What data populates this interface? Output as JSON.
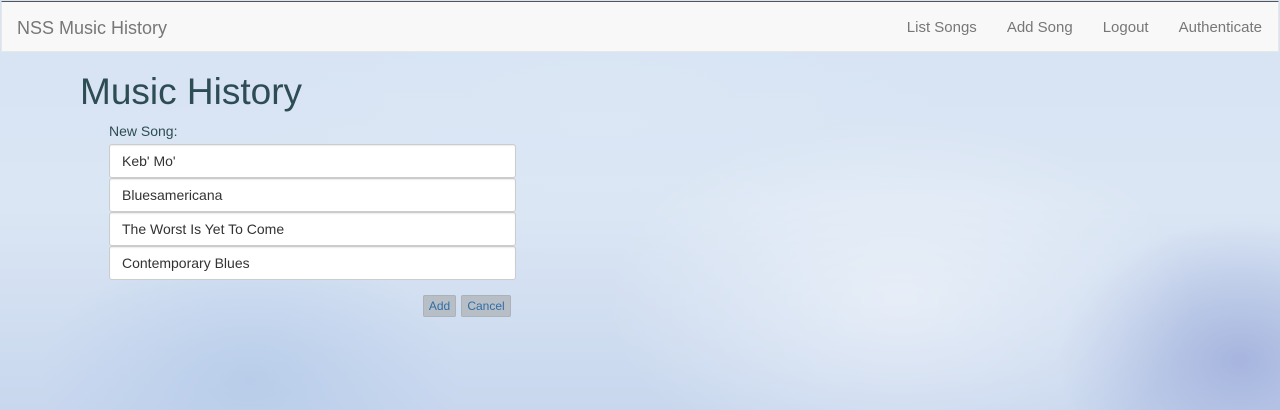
{
  "navbar": {
    "brand": "NSS Music History",
    "links": [
      "List Songs",
      "Add Song",
      "Logout",
      "Authenticate"
    ]
  },
  "main": {
    "title": "Music History",
    "form_label": "New Song:",
    "fields": [
      {
        "value": "Keb' Mo'"
      },
      {
        "value": "Bluesamericana"
      },
      {
        "value": "The Worst Is Yet To Come"
      },
      {
        "value": "Contemporary Blues"
      }
    ],
    "add_label": "Add",
    "cancel_label": "Cancel"
  }
}
